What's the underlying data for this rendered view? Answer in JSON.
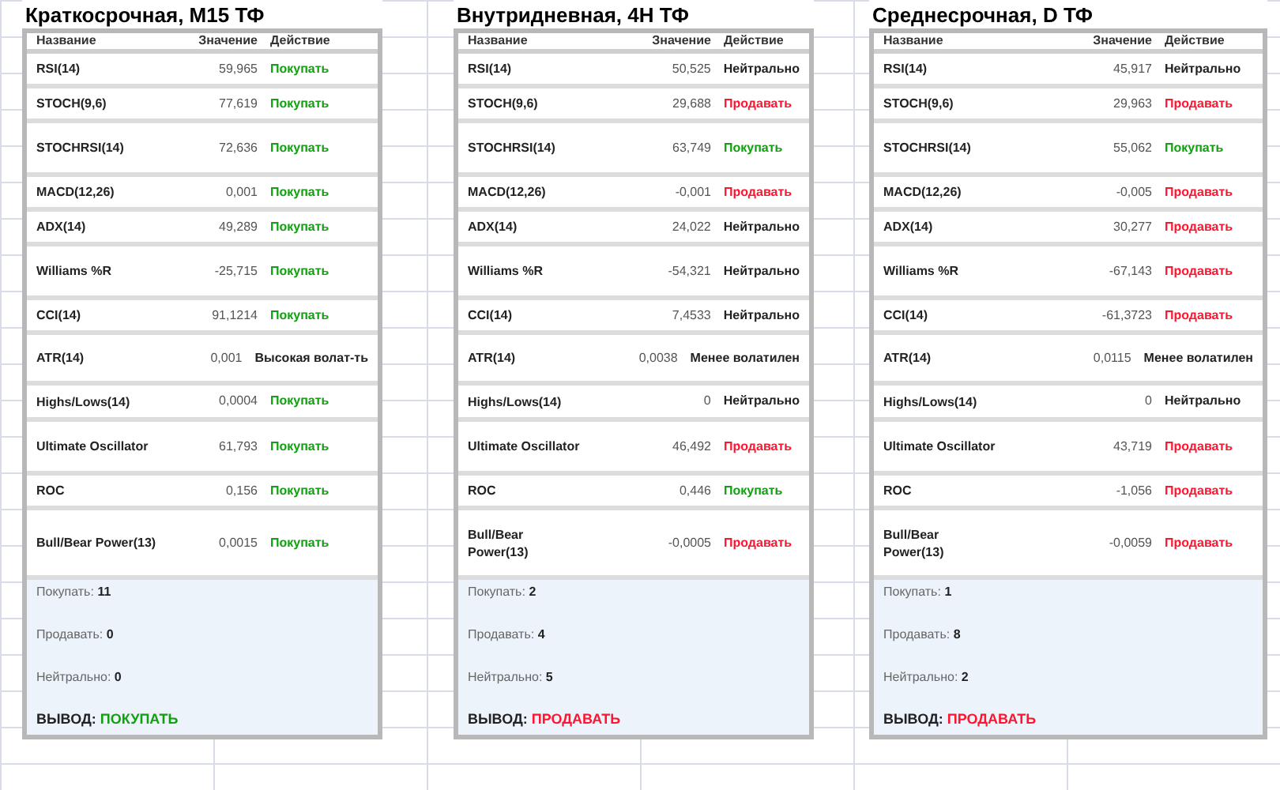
{
  "panels": [
    {
      "title": "Краткосрочная, M15 ТФ",
      "columns": [
        "Название",
        "Значение",
        "Действие"
      ],
      "rows": [
        {
          "name": "RSI(14)",
          "value": "59,965",
          "action": "Покупать",
          "color": "#12a012"
        },
        {
          "name": "STOCH(9,6)",
          "value": "77,619",
          "action": "Покупать",
          "color": "#12a012"
        },
        {
          "name": "STOCHRSI(14)",
          "value": "72,636",
          "action": "Покупать",
          "color": "#12a012"
        },
        {
          "name": "MACD(12,26)",
          "value": "0,001",
          "action": "Покупать",
          "color": "#12a012"
        },
        {
          "name": "ADX(14)",
          "value": "49,289",
          "action": "Покупать",
          "color": "#12a012"
        },
        {
          "name": "Williams %R",
          "value": "-25,715",
          "action": "Покупать",
          "color": "#12a012"
        },
        {
          "name": "CCI(14)",
          "value": "91,1214",
          "action": "Покупать",
          "color": "#12a012"
        },
        {
          "name": "ATR(14)",
          "value": "0,001",
          "action": "Высокая волат-ть",
          "color": "#222222"
        },
        {
          "name": "Highs/Lows(14)",
          "value": "0,0004",
          "action": "Покупать",
          "color": "#12a012"
        },
        {
          "name": "Ultimate Oscillator",
          "value": "61,793",
          "action": "Покупать",
          "color": "#12a012"
        },
        {
          "name": "ROC",
          "value": "0,156",
          "action": "Покупать",
          "color": "#12a012"
        },
        {
          "name": "Bull/Bear Power(13)",
          "value": "0,0015",
          "action": "Покупать",
          "color": "#12a012"
        }
      ],
      "summary": [
        {
          "label": "Покупать:",
          "count": "11"
        },
        {
          "label": "Продавать:",
          "count": "0"
        },
        {
          "label": "Нейтрально:",
          "count": "0"
        }
      ],
      "conclusion": {
        "label": "ВЫВОД:",
        "value": "ПОКУПАТЬ",
        "color": "#12a012"
      }
    },
    {
      "title": "Внутридневная, 4H ТФ",
      "columns": [
        "Название",
        "Значение",
        "Действие"
      ],
      "rows": [
        {
          "name": "RSI(14)",
          "value": "50,525",
          "action": "Нейтрально",
          "color": "#222222"
        },
        {
          "name": "STOCH(9,6)",
          "value": "29,688",
          "action": "Продавать",
          "color": "#ff1530"
        },
        {
          "name": "STOCHRSI(14)",
          "value": "63,749",
          "action": "Покупать",
          "color": "#12a012"
        },
        {
          "name": "MACD(12,26)",
          "value": "-0,001",
          "action": "Продавать",
          "color": "#ff1530"
        },
        {
          "name": "ADX(14)",
          "value": "24,022",
          "action": "Нейтрально",
          "color": "#222222"
        },
        {
          "name": "Williams %R",
          "value": "-54,321",
          "action": "Нейтрально",
          "color": "#222222"
        },
        {
          "name": "CCI(14)",
          "value": "7,4533",
          "action": "Нейтрально",
          "color": "#222222"
        },
        {
          "name": "ATR(14)",
          "value": "0,0038",
          "action": "Менее волатилен",
          "color": "#222222"
        },
        {
          "name": "Highs/Lows(14)",
          "value": "0",
          "action": "Нейтрально",
          "color": "#222222"
        },
        {
          "name": "Ultimate Oscillator",
          "value": "46,492",
          "action": "Продавать",
          "color": "#ff1530"
        },
        {
          "name": "ROC",
          "value": "0,446",
          "action": "Покупать",
          "color": "#12a012"
        },
        {
          "name": "Bull/Bear Power(13)",
          "value": "-0,0005",
          "action": "Продавать",
          "color": "#ff1530"
        }
      ],
      "summary": [
        {
          "label": "Покупать:",
          "count": "2"
        },
        {
          "label": "Продавать:",
          "count": "4"
        },
        {
          "label": "Нейтрально:",
          "count": "5"
        }
      ],
      "conclusion": {
        "label": "ВЫВОД:",
        "value": "ПРОДАВАТЬ",
        "color": "#ff1530"
      }
    },
    {
      "title": "Среднесрочная, D ТФ",
      "columns": [
        "Название",
        "Значение",
        "Действие"
      ],
      "rows": [
        {
          "name": "RSI(14)",
          "value": "45,917",
          "action": "Нейтрально",
          "color": "#222222"
        },
        {
          "name": "STOCH(9,6)",
          "value": "29,963",
          "action": "Продавать",
          "color": "#ff1530"
        },
        {
          "name": "STOCHRSI(14)",
          "value": "55,062",
          "action": "Покупать",
          "color": "#12a012"
        },
        {
          "name": "MACD(12,26)",
          "value": "-0,005",
          "action": "Продавать",
          "color": "#ff1530"
        },
        {
          "name": "ADX(14)",
          "value": "30,277",
          "action": "Продавать",
          "color": "#ff1530"
        },
        {
          "name": "Williams %R",
          "value": "-67,143",
          "action": "Продавать",
          "color": "#ff1530"
        },
        {
          "name": "CCI(14)",
          "value": "-61,3723",
          "action": "Продавать",
          "color": "#ff1530"
        },
        {
          "name": "ATR(14)",
          "value": "0,0115",
          "action": "Менее волатилен",
          "color": "#222222"
        },
        {
          "name": "Highs/Lows(14)",
          "value": "0",
          "action": "Нейтрально",
          "color": "#222222"
        },
        {
          "name": "Ultimate Oscillator",
          "value": "43,719",
          "action": "Продавать",
          "color": "#ff1530"
        },
        {
          "name": "ROC",
          "value": "-1,056",
          "action": "Продавать",
          "color": "#ff1530"
        },
        {
          "name": "Bull/Bear Power(13)",
          "value": "-0,0059",
          "action": "Продавать",
          "color": "#ff1530"
        }
      ],
      "summary": [
        {
          "label": "Покупать:",
          "count": "1"
        },
        {
          "label": "Продавать:",
          "count": "8"
        },
        {
          "label": "Нейтрально:",
          "count": "2"
        }
      ],
      "conclusion": {
        "label": "ВЫВОД:",
        "value": "ПРОДАВАТЬ",
        "color": "#ff1530"
      }
    }
  ]
}
